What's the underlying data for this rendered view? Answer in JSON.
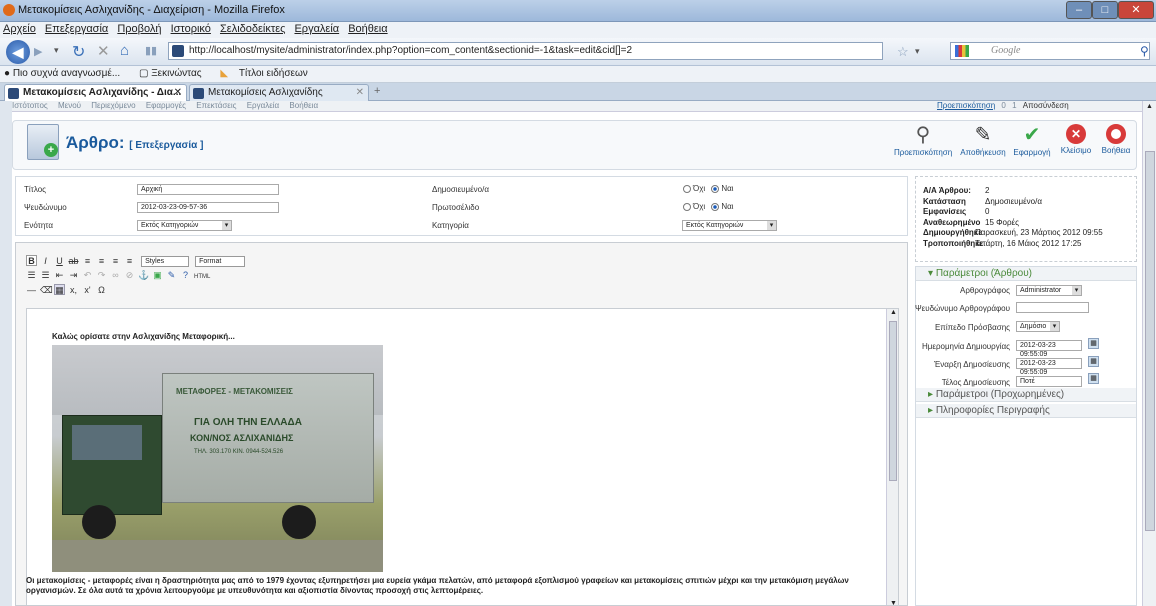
{
  "window": {
    "title": "Μετακομίσεις Ασλιχανίδης - Διαχείριση - Mozilla Firefox"
  },
  "menu": [
    "Αρχείο",
    "Επεξεργασία",
    "Προβολή",
    "Ιστορικό",
    "Σελιδοδείκτες",
    "Εργαλεία",
    "Βοήθεια"
  ],
  "url": "http://localhost/mysite/administrator/index.php?option=com_content&sectionid=-1&task=edit&cid[]=2",
  "search_placeholder": "Google",
  "bookmarks": [
    "Πιο συχνά αναγνωσμέ...",
    "Ξεκινώντας",
    "Τίτλοι ειδήσεων"
  ],
  "tabs": [
    "Μετακομίσεις Ασλιχανίδης - Δια...",
    "Μετακομίσεις Ασλιχανίδης"
  ],
  "admin_menu": [
    "Ιστότοπος",
    "Μενού",
    "Περιεχόμενο",
    "Εφαρμογές",
    "Επεκτάσεις",
    "Εργαλεία",
    "Βοήθεια"
  ],
  "admin_status": {
    "preview": "Προεπισκόπηση",
    "count0": "0",
    "count1": "1",
    "logout": "Αποσύνδεση"
  },
  "page": {
    "title": "Άρθρο:",
    "subtitle": "[ Επεξεργασία ]"
  },
  "toolbar": {
    "preview": "Προεπισκόπηση",
    "save": "Αποθήκευση",
    "apply": "Εφαρμογή",
    "close": "Κλείσιμο",
    "help": "Βοήθεια"
  },
  "form": {
    "title_label": "Τίτλος",
    "title_value": "Αρχική",
    "alias_label": "Ψευδώνυμο",
    "alias_value": "2012-03-23-09-57-36",
    "section_label": "Ενότητα",
    "section_value": "Εκτός Κατηγοριών",
    "published_label": "Δημοσιευμένο/α",
    "frontpage_label": "Πρωτοσέλιδο",
    "category_label": "Κατηγορία",
    "category_value": "Εκτός Κατηγοριών",
    "no": "Όχι",
    "yes": "Ναι"
  },
  "editor": {
    "styles": "Styles",
    "format": "Format",
    "html": "HTML",
    "heading": "Καλώς ορίσατε στην Ασλιχανίδης  Μεταφορική...",
    "truck_text1": "ΜΕΤΑΦΟΡΕΣ - ΜΕΤΑΚΟΜΙΣΕΙΣ",
    "truck_text2": "ΓΙΑ ΟΛΗ ΤΗΝ ΕΛΛΑΔΑ",
    "truck_text3": "ΚΟΝ/ΝΟΣ  ΑΣΛΙΧΑΝΙΔΗΣ",
    "truck_text4": "ΤΗΛ. 303.170  ΚΙΝ. 0944-524.526",
    "body": "Οι μετακομίσεις - μεταφορές είναι η δραστηριότητα μας από το 1979 έχοντας εξυπηρετήσει μια ευρεία γκάμα πελατών, από μεταφορά εξοπλισμού γραφείων και μετακομίσεις σπιτιών μέχρι και την μετακόμιση μεγάλων οργανισμών. Σε όλα αυτά τα χρόνια λειτουργούμε με υπευθυνότητα και αξιοπιστία δίνοντας προσοχή στις λεπτομέρειες."
  },
  "meta": [
    {
      "k": "Α/Α Άρθρου:",
      "v": "2"
    },
    {
      "k": "Κατάσταση",
      "v": "Δημοσιευμένο/α"
    },
    {
      "k": "Εμφανίσεις",
      "v": "0"
    },
    {
      "k": "Αναθεωρημένο",
      "v": "15 Φορές"
    },
    {
      "k": "Δημιουργήθηκε",
      "v": "Παρασκευή, 23 Μάρτιος 2012 09:55"
    },
    {
      "k": "Τροποποιήθηκε",
      "v": "Τετάρτη, 16 Μάιος 2012 17:25"
    }
  ],
  "params": {
    "header": "Παράμετροι (Άρθρου)",
    "author_label": "Αρθρογράφος",
    "author_value": "Administrator",
    "alias_label": "Ψευδώνυμο Αρθρογράφου",
    "access_label": "Επίπεδο Πρόσβασης",
    "access_value": "Δημόσιο",
    "created_label": "Ημερομηνία Δημιουργίας",
    "created_value": "2012-03-23 09:55:09",
    "start_label": "Έναρξη Δημοσίευσης",
    "start_value": "2012-03-23 09:55:09",
    "end_label": "Τέλος Δημοσίευσης",
    "end_value": "Ποτέ",
    "advanced": "Παράμετροι (Προχωρημένες)",
    "metadata": "Πληροφορίες Περιγραφής"
  }
}
